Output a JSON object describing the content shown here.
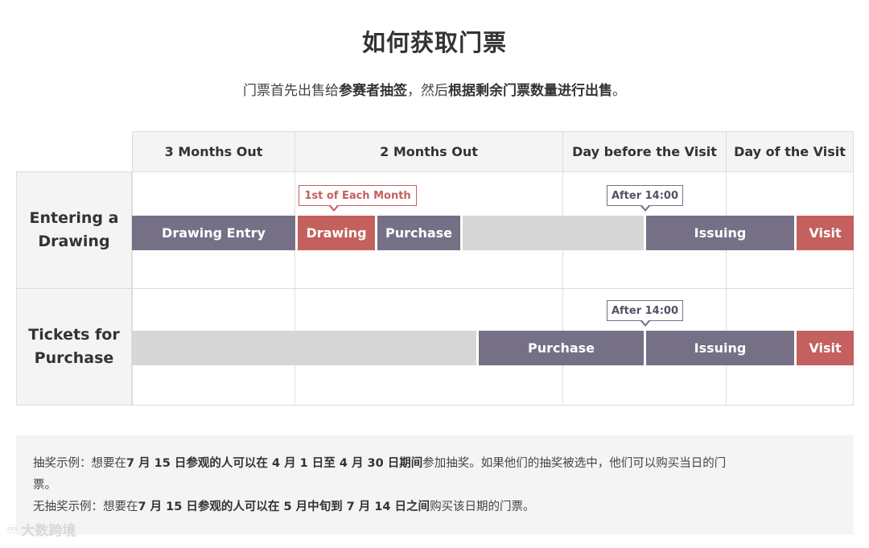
{
  "title": "如何获取门票",
  "subtitle": {
    "p1": "门票首先出售给",
    "b1": "参赛者抽签",
    "p2": "，然后",
    "b2": "根据剩余门票数量进行出售",
    "p3": "。"
  },
  "columns": [
    "3 Months Out",
    "2 Months Out",
    "Day before the Visit",
    "Day of the Visit"
  ],
  "rows": {
    "drawing": {
      "label_line1": "Entering a",
      "label_line2": "Drawing",
      "callout_red": "1st of Each Month",
      "callout_after": "After 14:00",
      "bars": {
        "drawing_entry": "Drawing Entry",
        "drawing": "Drawing",
        "purchase": "Purchase",
        "issuing": "Issuing",
        "visit": "Visit"
      }
    },
    "purchase": {
      "label_line1": "Tickets for",
      "label_line2": "Purchase",
      "callout_after": "After 14:00",
      "bars": {
        "purchase": "Purchase",
        "issuing": "Issuing",
        "visit": "Visit"
      }
    }
  },
  "notes": {
    "line1": {
      "p1": "抽奖示例：想要在",
      "b1": "7 月 15 日参观的人可以在 4 月 1 日至 4 月 30 日期间",
      "p2": "参加抽奖。如果他们的抽奖被选中，他们可以购买当日的门",
      "p3": "票。"
    },
    "line2": {
      "p1": "无抽奖示例：想要在",
      "b1": "7 月 15 日参观的人可以在 5 月中旬到 7 月 14 日之间",
      "p2": "购买该日期的门票。"
    }
  },
  "watermark": "大数跨境",
  "colors": {
    "purple": "#767086",
    "red": "#c4605d",
    "grey": "#d6d6d6",
    "header_bg": "#f4f4f4"
  }
}
